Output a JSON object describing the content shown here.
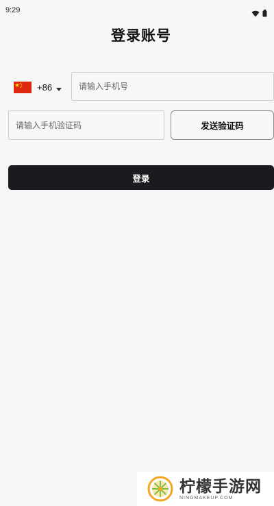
{
  "status_bar": {
    "time": "9:29",
    "icons": [
      "wifi-icon",
      "battery-icon"
    ]
  },
  "page": {
    "title": "登录账号"
  },
  "phone": {
    "country_flag": "china-flag-icon",
    "country_code": "+86",
    "placeholder": "请输入手机号",
    "value": ""
  },
  "verification": {
    "placeholder": "请输入手机验证码",
    "value": "",
    "send_label": "发送验证码"
  },
  "login": {
    "label": "登录"
  },
  "watermark": {
    "title": "柠檬手游网",
    "url": "NINGMAKEUP.COM"
  },
  "colors": {
    "background": "#f7f7f7",
    "login_button": "#1b1b1f",
    "flag_red": "#de2910",
    "flag_yellow": "#ffde00",
    "logo_orange": "#f5a623",
    "logo_green": "#7cc242"
  }
}
